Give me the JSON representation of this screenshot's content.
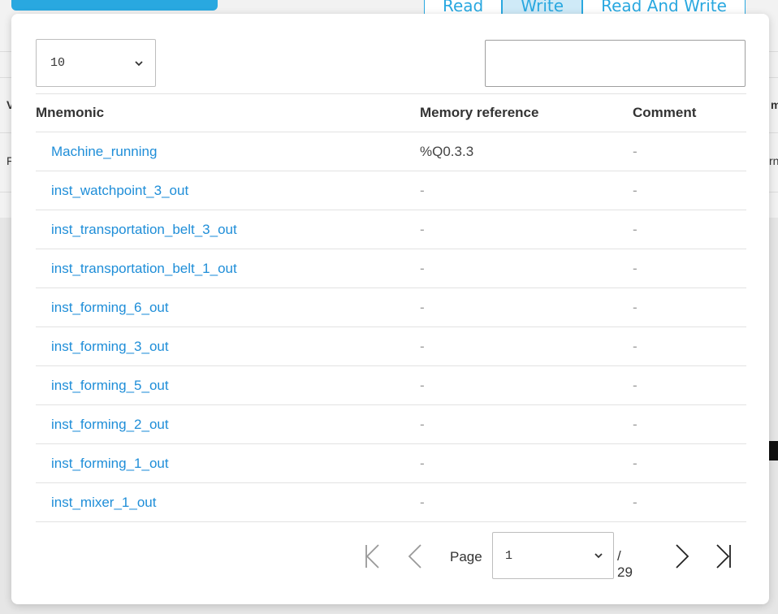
{
  "background": {
    "tabs": [
      {
        "label": "Read",
        "active": false
      },
      {
        "label": "Write",
        "active": true
      },
      {
        "label": "Read And Write",
        "active": false
      }
    ],
    "left_edge_header": "V",
    "left_edge_cell": "F",
    "right_edge_header": "m",
    "right_edge_cell": "rn"
  },
  "modal": {
    "page_size": {
      "value": "10"
    },
    "search": {
      "value": "",
      "placeholder": ""
    },
    "table": {
      "headers": [
        "Mnemonic",
        "Memory reference",
        "Comment"
      ],
      "rows": [
        {
          "mnemonic": "Machine_running",
          "memory_reference": "%Q0.3.3",
          "comment": "-"
        },
        {
          "mnemonic": "inst_watchpoint_3_out",
          "memory_reference": "-",
          "comment": "-"
        },
        {
          "mnemonic": "inst_transportation_belt_3_out",
          "memory_reference": "-",
          "comment": "-"
        },
        {
          "mnemonic": "inst_transportation_belt_1_out",
          "memory_reference": "-",
          "comment": "-"
        },
        {
          "mnemonic": "inst_forming_6_out",
          "memory_reference": "-",
          "comment": "-"
        },
        {
          "mnemonic": "inst_forming_3_out",
          "memory_reference": "-",
          "comment": "-"
        },
        {
          "mnemonic": "inst_forming_5_out",
          "memory_reference": "-",
          "comment": "-"
        },
        {
          "mnemonic": "inst_forming_2_out",
          "memory_reference": "-",
          "comment": "-"
        },
        {
          "mnemonic": "inst_forming_1_out",
          "memory_reference": "-",
          "comment": "-"
        },
        {
          "mnemonic": "inst_mixer_1_out",
          "memory_reference": "-",
          "comment": "-"
        }
      ]
    },
    "pagination": {
      "page_label": "Page",
      "current_page": "1",
      "total_label": "/ 29",
      "icons": [
        "first-page-icon",
        "previous-page-icon",
        "next-page-icon",
        "last-page-icon"
      ]
    }
  },
  "colors": {
    "accent": "#29a8e0",
    "link": "#1f8ed8",
    "border": "#e2e2e2"
  }
}
